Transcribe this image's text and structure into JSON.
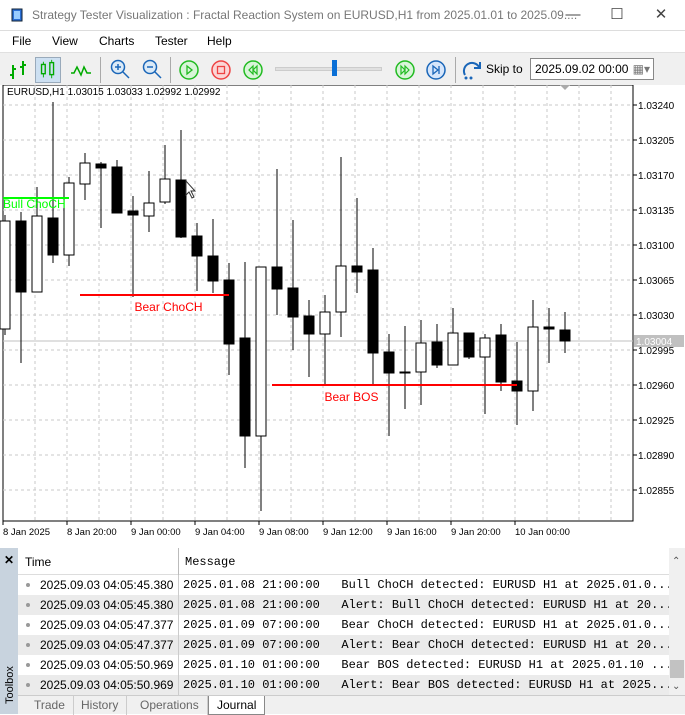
{
  "window": {
    "title": "Strategy Tester Visualization : Fractal Reaction System on EURUSD,H1 from 2025.01.01 to 2025.09....",
    "minimize": "—",
    "maximize": "☐",
    "close": "✕"
  },
  "menu": [
    "File",
    "View",
    "Charts",
    "Tester",
    "Help"
  ],
  "toolbar": {
    "skip_label": "Skip to",
    "skip_value": "2025.09.02 00:00",
    "speed_fraction": 0.55
  },
  "chart": {
    "symbol_info": "EURUSD,H1  1.03015 1.03033 1.02992 1.02992",
    "current_price": "1.03004",
    "y_ticks": [
      "1.03240",
      "1.03205",
      "1.03170",
      "1.03135",
      "1.03100",
      "1.03065",
      "1.03030",
      "1.02995",
      "1.02960",
      "1.02925",
      "1.02890",
      "1.02855"
    ],
    "x_ticks": [
      "8 Jan 2025",
      "8 Jan 20:00",
      "9 Jan 00:00",
      "9 Jan 04:00",
      "9 Jan 08:00",
      "9 Jan 12:00",
      "9 Jan 16:00",
      "9 Jan 20:00",
      "10 Jan 00:00"
    ],
    "annotations": [
      {
        "label": "Bull ChoCH",
        "price": 1.03147,
        "from_bar": 0,
        "to_bar": 4,
        "color": "#00ff00"
      },
      {
        "label": "Bear ChoCH",
        "price": 1.0305,
        "from_bar": 5,
        "to_bar": 14,
        "color": "#ff0000"
      },
      {
        "label": "Bear BOS",
        "price": 1.0296,
        "from_bar": 17,
        "to_bar": 32,
        "color": "#ff0000"
      }
    ],
    "ohlc": [
      [
        1.03016,
        1.0313,
        1.0301,
        1.03124
      ],
      [
        1.03124,
        1.03133,
        1.02982,
        1.03053
      ],
      [
        1.03053,
        1.03158,
        1.03053,
        1.03129
      ],
      [
        1.03127,
        1.03243,
        1.03082,
        1.0309
      ],
      [
        1.0309,
        1.03168,
        1.03079,
        1.03162
      ],
      [
        1.03161,
        1.03192,
        1.03145,
        1.03182
      ],
      [
        1.03181,
        1.03183,
        1.03117,
        1.03177
      ],
      [
        1.03178,
        1.03185,
        1.03132,
        1.03132
      ],
      [
        1.03134,
        1.03149,
        1.03048,
        1.0313
      ],
      [
        1.03129,
        1.03174,
        1.03113,
        1.03142
      ],
      [
        1.03143,
        1.032,
        1.03141,
        1.03166
      ],
      [
        1.03165,
        1.03215,
        1.03107,
        1.03108
      ],
      [
        1.03109,
        1.03122,
        1.03054,
        1.03089
      ],
      [
        1.03089,
        1.03126,
        1.03052,
        1.03064
      ],
      [
        1.03065,
        1.03082,
        1.0297,
        1.03001
      ],
      [
        1.03007,
        1.03083,
        1.02877,
        1.02909
      ],
      [
        1.02909,
        1.03078,
        1.02834,
        1.03078
      ],
      [
        1.03078,
        1.03176,
        1.0303,
        1.03056
      ],
      [
        1.03057,
        1.03125,
        1.02995,
        1.03028
      ],
      [
        1.03029,
        1.03045,
        1.02968,
        1.03011
      ],
      [
        1.03011,
        1.0305,
        1.0296,
        1.03033
      ],
      [
        1.03033,
        1.03188,
        1.03008,
        1.03079
      ],
      [
        1.03079,
        1.03147,
        1.03052,
        1.03073
      ],
      [
        1.03075,
        1.03097,
        1.0296,
        1.02992
      ],
      [
        1.02993,
        1.03011,
        1.02909,
        1.02972
      ],
      [
        1.02973,
        1.03019,
        1.02936,
        1.02972
      ],
      [
        1.02973,
        1.03025,
        1.0294,
        1.03002
      ],
      [
        1.03003,
        1.03021,
        1.02977,
        1.0298
      ],
      [
        1.0298,
        1.03037,
        1.0298,
        1.03012
      ],
      [
        1.03012,
        1.03012,
        1.02986,
        1.02988
      ],
      [
        1.02988,
        1.03011,
        1.02931,
        1.03007
      ],
      [
        1.0301,
        1.03021,
        1.02954,
        1.02963
      ],
      [
        1.02964,
        1.03003,
        1.0292,
        1.02954
      ],
      [
        1.02954,
        1.03045,
        1.02934,
        1.03018
      ],
      [
        1.03018,
        1.03037,
        1.02982,
        1.03016
      ],
      [
        1.03015,
        1.03033,
        1.02992,
        1.03004
      ]
    ]
  },
  "journal": {
    "columns": [
      "Time",
      "Message"
    ],
    "rows": [
      {
        "time": "2025.09.03 04:05:45.380",
        "message": "2025.01.08 21:00:00   Bull ChoCH detected: EURUSD H1 at 2025.01.0..."
      },
      {
        "time": "2025.09.03 04:05:45.380",
        "message": "2025.01.08 21:00:00   Alert: Bull ChoCH detected: EURUSD H1 at 20..."
      },
      {
        "time": "2025.09.03 04:05:47.377",
        "message": "2025.01.09 07:00:00   Bear ChoCH detected: EURUSD H1 at 2025.01.0..."
      },
      {
        "time": "2025.09.03 04:05:47.377",
        "message": "2025.01.09 07:00:00   Alert: Bear ChoCH detected: EURUSD H1 at 20..."
      },
      {
        "time": "2025.09.03 04:05:50.969",
        "message": "2025.01.10 01:00:00   Bear BOS detected: EURUSD H1 at 2025.01.10 ..."
      },
      {
        "time": "2025.09.03 04:05:50.969",
        "message": "2025.01.10 01:00:00   Alert: Bear BOS detected: EURUSD H1 at 2025..."
      }
    ],
    "tabs": [
      "Trade",
      "History",
      "Operations",
      "Journal"
    ],
    "active_tab": "Journal",
    "toolbox_label": "Toolbox",
    "close": "✕"
  }
}
